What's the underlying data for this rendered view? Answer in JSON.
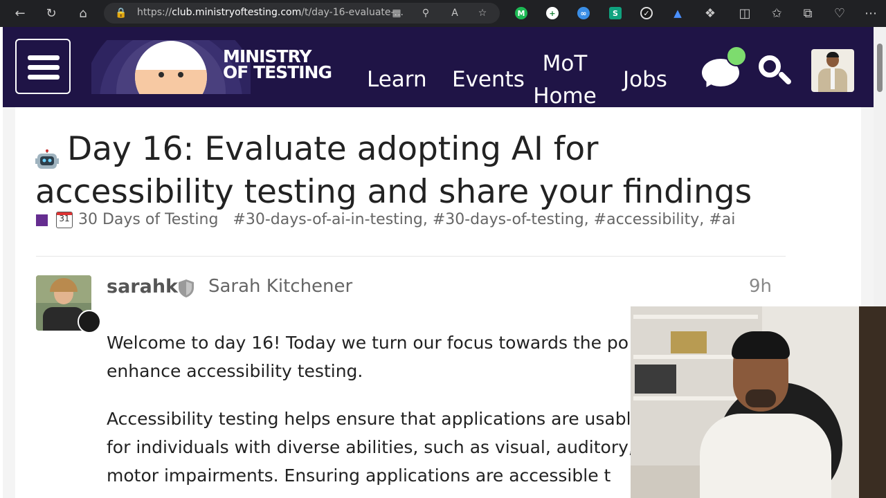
{
  "browser": {
    "url_prefix": "https://",
    "url_host": "club.ministryoftesting.com",
    "url_path": "/t/day-16-evaluate-...",
    "nav_icons": [
      "back-arrow-icon",
      "refresh-icon",
      "home-icon"
    ],
    "url_icons": [
      "lock-icon",
      "apps-grid-icon",
      "zoom-icon",
      "read-aloud-icon",
      "favorite-star-icon"
    ],
    "extension_icons": [
      "m-extension-icon",
      "plus-extension-icon",
      "glasses-extension-icon",
      "s-extension-icon",
      "check-extension-icon",
      "triangle-extension-icon",
      "puzzle-extensions-icon",
      "split-screen-icon",
      "favorites-icon",
      "collections-icon",
      "heart-pulse-icon",
      "more-dots-icon"
    ]
  },
  "site": {
    "brand_line1": "MINISTRY",
    "brand_line2": "OF TESTING",
    "nav": {
      "learn": "Learn",
      "events": "Events",
      "home_line1": "MoT",
      "home_line2": "Home",
      "jobs": "Jobs"
    },
    "colors": {
      "header_bg": "#1f1446",
      "notification": "#7ddc6e",
      "category": "#652d90"
    }
  },
  "topic": {
    "title": "Day 16: Evaluate adopting AI for accessibility testing and share your findings",
    "category": "30 Days of Testing",
    "calendar_day": "31",
    "tags": [
      "#30-days-of-ai-in-testing",
      "#30-days-of-testing",
      "#accessibility",
      "#ai"
    ]
  },
  "post": {
    "username": "sarahk",
    "full_name": "Sarah Kitchener",
    "time": "9h",
    "paragraphs": [
      "Welcome to day 16! Today we turn our focus towards the po",
      "enhance accessibility testing.",
      "Accessibility testing helps ensure that applications are usabl",
      "for individuals with diverse abilities, such as visual, auditory,",
      "motor impairments. Ensuring applications are accessible t"
    ]
  }
}
